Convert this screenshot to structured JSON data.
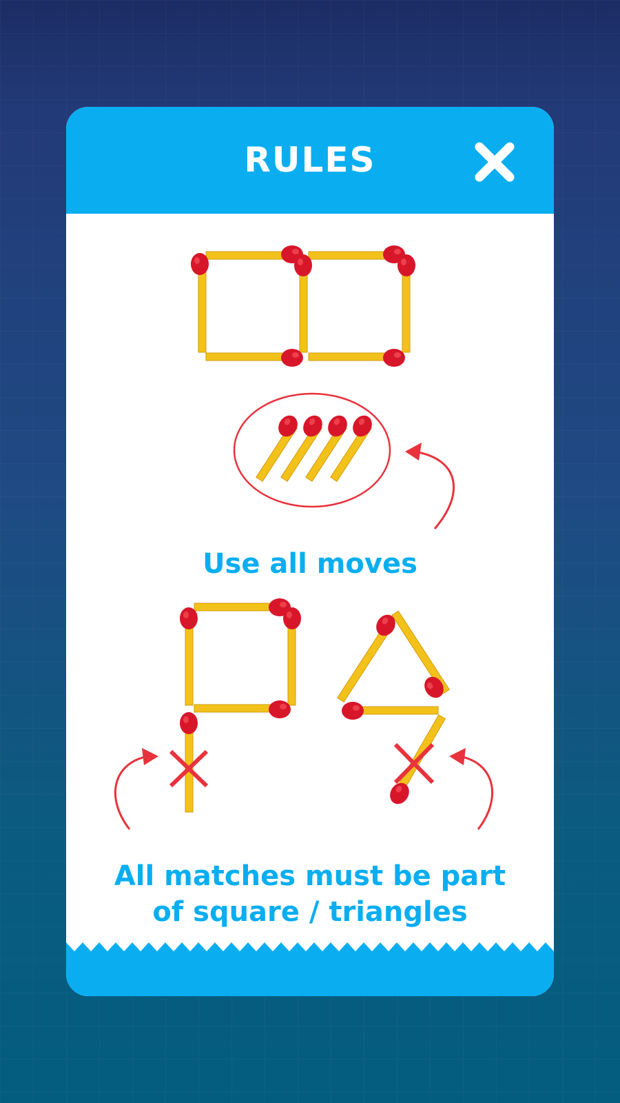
{
  "dialog": {
    "title": "RULES",
    "close_icon": "close-icon",
    "rule_use_all_moves": "Use all moves",
    "rule_all_matches_line1": "All matches must be part",
    "rule_all_matches_line2": "of square / triangles"
  },
  "colors": {
    "accent_blue": "#0aaef0",
    "match_stick": "#f2c21b",
    "match_head": "#d8162a",
    "annotation_red": "#e8323c"
  }
}
